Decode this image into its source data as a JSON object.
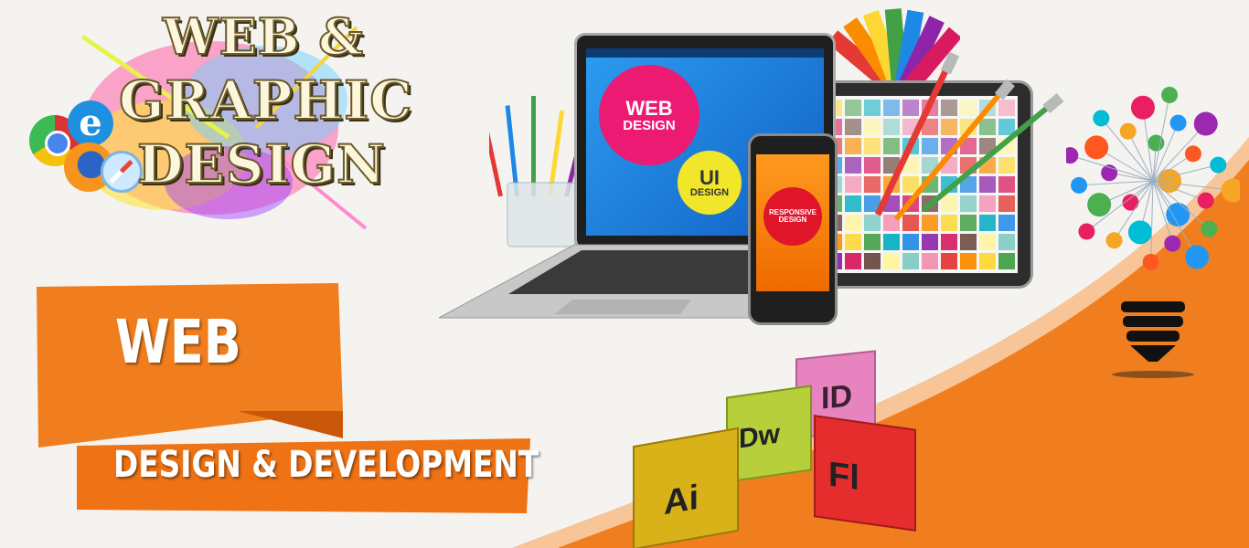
{
  "hero": {
    "title_line1": "WEB &",
    "title_line2": "GRAPHIC",
    "title_line3": "DESIGN"
  },
  "laptop": {
    "circle_web": "WEB",
    "circle_design": "DESIGN",
    "circle_ui": "UI",
    "circle_ui_design": "DESIGN"
  },
  "phone": {
    "label_line1": "RESPONSIVE",
    "label_line2": "DESIGN"
  },
  "banner": {
    "top_word": "WEB",
    "bottom_line": "DESIGN & DEVELOPMENT"
  },
  "cubes": {
    "ai": "Ai",
    "dw": "Dw",
    "id": "ID",
    "fl": "Fl"
  },
  "colors": {
    "orange": "#f07e1e",
    "orange_dark": "#e2650d",
    "magenta": "#ec1a73",
    "yellow": "#f2e62b",
    "screen_blue": "#1f7fe0"
  },
  "icons": [
    "chrome-icon",
    "ie-icon",
    "firefox-icon",
    "safari-icon",
    "lightbulb-icon"
  ]
}
